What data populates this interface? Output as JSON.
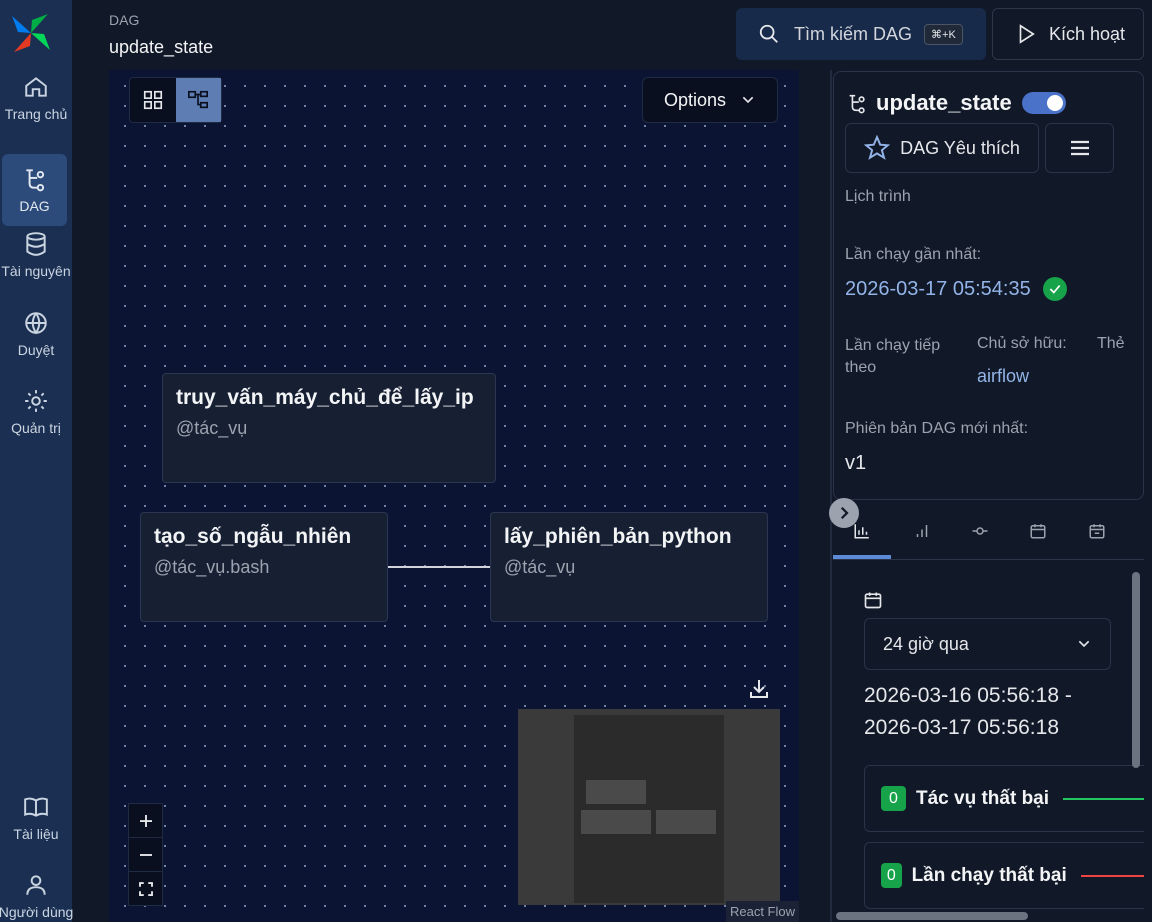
{
  "sidebar": {
    "items": [
      {
        "label": "Trang chủ",
        "icon": "home-icon"
      },
      {
        "label": "DAG",
        "icon": "dag-icon"
      },
      {
        "label": "Tài nguyên",
        "icon": "database-icon"
      },
      {
        "label": "Duyệt",
        "icon": "globe-icon"
      },
      {
        "label": "Quản trị",
        "icon": "gear-icon"
      },
      {
        "label": "Tài liệu",
        "icon": "book-icon"
      },
      {
        "label": "Người dùng",
        "icon": "user-icon"
      }
    ],
    "active": "DAG"
  },
  "header": {
    "section": "DAG",
    "title": "update_state",
    "search_label": "Tìm kiếm DAG",
    "search_shortcut": "⌘+K",
    "trigger_label": "Kích hoạt"
  },
  "graph": {
    "options_label": "Options",
    "nodes": [
      {
        "title": "truy_vấn_máy_chủ_để_lấy_ip",
        "operator": "@tác_vụ"
      },
      {
        "title": "tạo_số_ngẫu_nhiên",
        "operator": "@tác_vụ.bash"
      },
      {
        "title": "lấy_phiên_bản_python",
        "operator": "@tác_vụ"
      }
    ],
    "attribution": "React Flow"
  },
  "details": {
    "dag_id": "update_state",
    "paused": false,
    "favorite_label": "DAG Yêu thích",
    "schedule_label": "Lịch trình",
    "last_run_label": "Lần chạy gần nhất:",
    "last_run_value": "2026-03-17 05:54:35",
    "last_run_status": "success",
    "next_run_label": "Lần chạy tiếp theo",
    "owner_label": "Chủ sở hữu:",
    "owner_value": "airflow",
    "tags_label": "Thẻ",
    "version_label": "Phiên bản DAG mới nhất:",
    "version_value": "v1"
  },
  "stats": {
    "range_option": "24 giờ qua",
    "range_start": "2026-03-16 05:56:18 -",
    "range_end": "2026-03-17 05:56:18",
    "cards": [
      {
        "count": "0",
        "label": "Tác vụ thất bại",
        "color": "#22c55e"
      },
      {
        "count": "0",
        "label": "Lần chạy thất bại",
        "color": "#ef4444"
      }
    ]
  }
}
